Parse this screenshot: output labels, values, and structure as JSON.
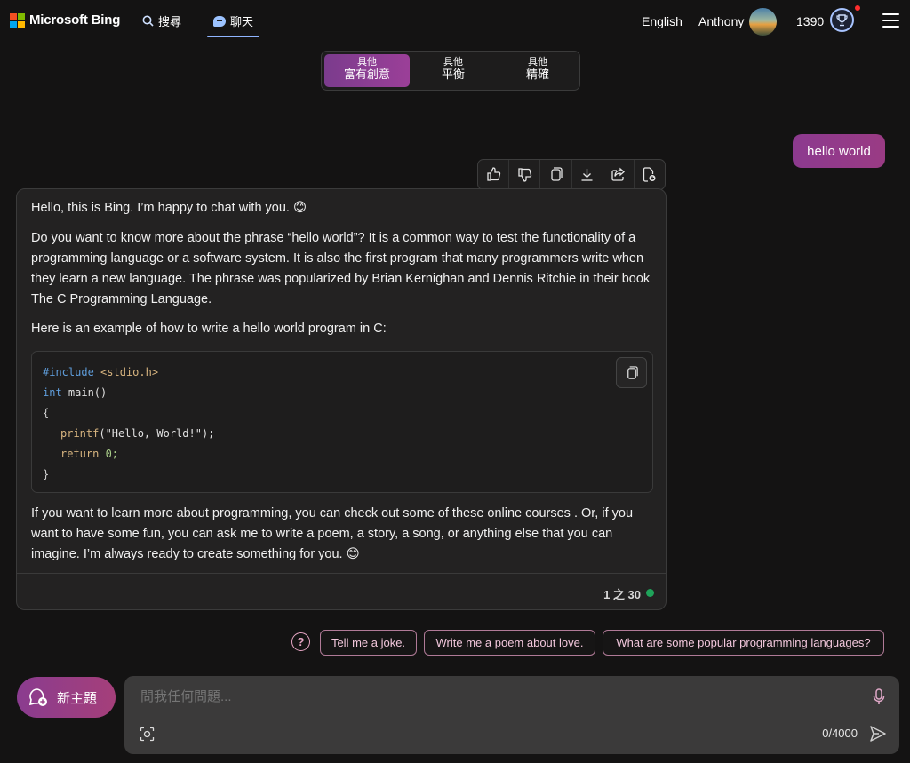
{
  "topbar": {
    "brand": "Microsoft Bing",
    "nav": {
      "search": "搜尋",
      "chat": "聊天"
    },
    "language": "English",
    "user_name": "Anthony",
    "points": "1390"
  },
  "tones": [
    {
      "line1": "具他",
      "line2": "富有創意",
      "active": true
    },
    {
      "line1": "具他",
      "line2": "平衡",
      "active": false
    },
    {
      "line1": "具他",
      "line2": "精確",
      "active": false
    }
  ],
  "conversation": {
    "user_message": "hello world",
    "bot": {
      "p1": "Hello, this is Bing. I’m happy to chat with you. 😊",
      "p2": "Do you want to know more about the phrase “hello world”? It is a common way to test the functionality of a programming language or a software system. It is also the first program that many programmers write when they learn a new language. The phrase was popularized by Brian Kernighan and Dennis Ritchie in their book The C Programming Language.",
      "p3": "Here is an example of how to write a hello world program in C:",
      "code": {
        "include_kw": "#include",
        "include_hdr": " <stdio.h>",
        "int_kw": "int",
        "main_fn": " main()",
        "open_brace": "{",
        "printf_fn": "printf",
        "printf_arg": "(\"Hello, World!\");",
        "return_kw": "return",
        "return_val": " 0;",
        "close_brace": "}"
      },
      "p4": "If you want to learn more about programming, you can check out some of these online courses . Or, if you want to have some fun, you can ask me to write a poem, a story, a song, or anything else that you can imagine. I’m always ready to create something for you. 😊",
      "counter": "1 之 30"
    }
  },
  "suggestions": [
    "Tell me a joke.",
    "Write me a poem about love.",
    "What are some popular programming languages?"
  ],
  "composer": {
    "new_topic": "新主題",
    "placeholder": "問我任何問題...",
    "char_count": "0/4000"
  },
  "colors": {
    "accent": "#9b3f98",
    "status_online": "#1fa35a",
    "notification": "#ff2d2d"
  }
}
